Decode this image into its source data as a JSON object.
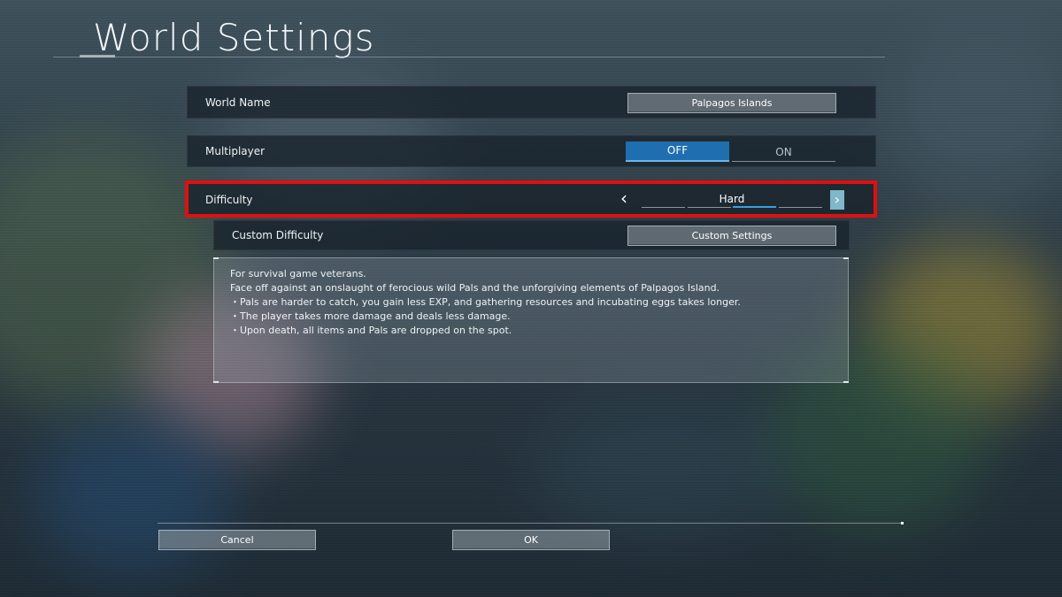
{
  "page": {
    "title": "World Settings"
  },
  "world_name": {
    "label": "World Name",
    "value": "Palpagos Islands"
  },
  "multiplayer": {
    "label": "Multiplayer",
    "off_label": "OFF",
    "on_label": "ON",
    "selected": "OFF"
  },
  "difficulty": {
    "label": "Difficulty",
    "value": "Hard",
    "prev_icon": "chevron-left-icon",
    "next_icon": "chevron-right-icon"
  },
  "custom_difficulty": {
    "label": "Custom Difficulty",
    "button": "Custom Settings"
  },
  "description": {
    "lines": [
      "For survival game veterans.",
      "Face off against an onslaught of ferocious wild Pals and the unforgiving elements of Palpagos Island.",
      "・Pals are harder to catch, you gain less EXP, and gathering resources and incubating eggs takes longer.",
      "・The player takes more damage and deals less damage.",
      "・Upon death, all items and Pals are dropped on the spot."
    ]
  },
  "footer": {
    "cancel": "Cancel",
    "ok": "OK"
  },
  "colors": {
    "accent": "#1f6fb0",
    "highlight": "#e01010",
    "panel": "#18222c"
  }
}
